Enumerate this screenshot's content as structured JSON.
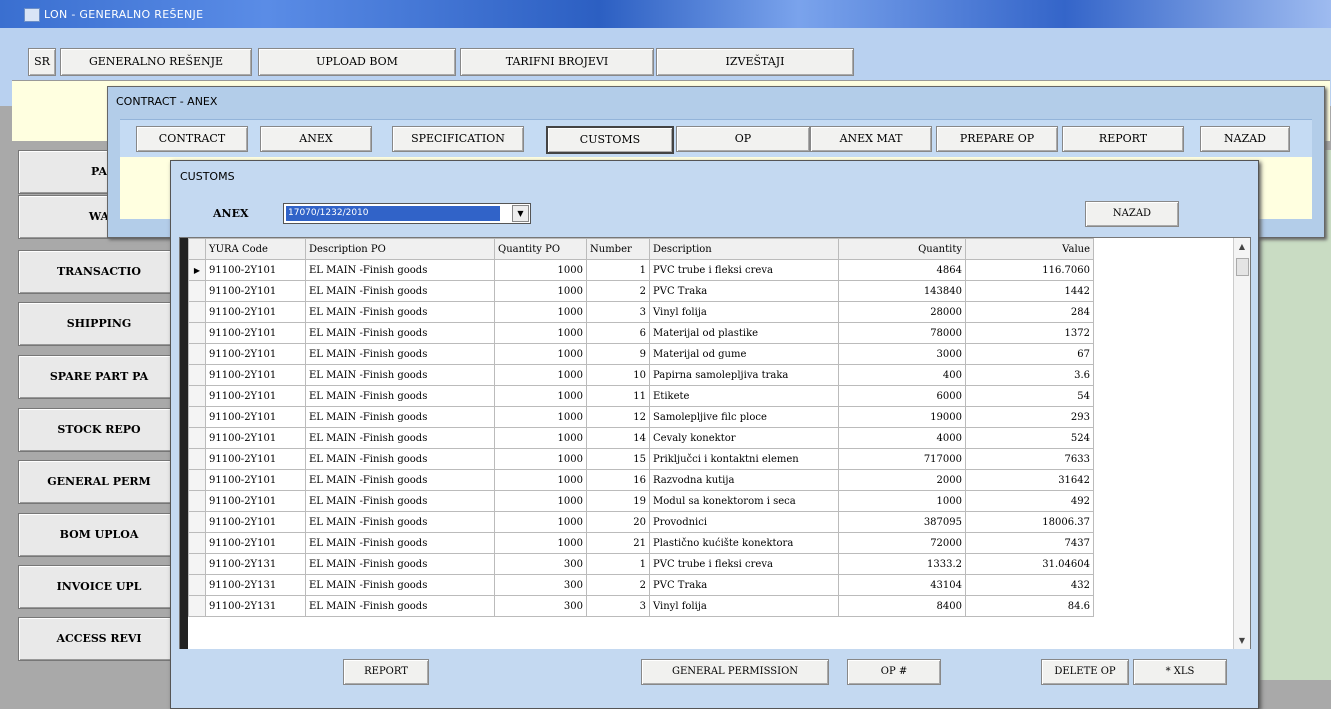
{
  "window_title": "LON - GENERALNO REŠENJE",
  "top_nav": [
    {
      "label": "SR"
    },
    {
      "label": "GENERALNO REŠENJE"
    },
    {
      "label": "UPLOAD BOM"
    },
    {
      "label": "TARIFNI BROJEVI"
    },
    {
      "label": "IZVEŠTAJI"
    }
  ],
  "sidebar": [
    {
      "label": "PA"
    },
    {
      "label": "WA"
    },
    {
      "label": "TRANSACTIO"
    },
    {
      "label": "SHIPPING"
    },
    {
      "label": "SPARE PART PA"
    },
    {
      "label": "STOCK REPO"
    },
    {
      "label": "GENERAL PERM"
    },
    {
      "label": "BOM UPLOA"
    },
    {
      "label": "INVOICE UPL"
    },
    {
      "label": "ACCESS REVI"
    }
  ],
  "contract_window": {
    "title": "CONTRACT - ANEX",
    "buttons": [
      {
        "label": "CONTRACT"
      },
      {
        "label": "ANEX"
      },
      {
        "label": "SPECIFICATION"
      },
      {
        "label": "CUSTOMS"
      },
      {
        "label": "OP"
      },
      {
        "label": "ANEX MAT"
      },
      {
        "label": "PREPARE OP"
      },
      {
        "label": "REPORT"
      },
      {
        "label": "NAZAD"
      }
    ]
  },
  "customs_window": {
    "title": "CUSTOMS",
    "anex_label": "ANEX",
    "anex_value": "17070/1232/2010",
    "nazad_label": "NAZAD",
    "columns": [
      "YURA Code",
      "Description PO",
      "Quantity PO",
      "Number",
      "Description",
      "Quantity",
      "Value"
    ],
    "rows": [
      [
        "91100-2Y101",
        "EL MAIN -Finish goods",
        "1000",
        "1",
        "PVC trube i fleksi creva",
        "4864",
        "116.7060"
      ],
      [
        "91100-2Y101",
        "EL MAIN -Finish goods",
        "1000",
        "2",
        "PVC Traka",
        "143840",
        "1442"
      ],
      [
        "91100-2Y101",
        "EL MAIN -Finish goods",
        "1000",
        "3",
        "Vinyl folija",
        "28000",
        "284"
      ],
      [
        "91100-2Y101",
        "EL MAIN -Finish goods",
        "1000",
        "6",
        "Materijal od plastike",
        "78000",
        "1372"
      ],
      [
        "91100-2Y101",
        "EL MAIN -Finish goods",
        "1000",
        "9",
        "Materijal od gume",
        "3000",
        "67"
      ],
      [
        "91100-2Y101",
        "EL MAIN -Finish goods",
        "1000",
        "10",
        "Papirna samolepljiva traka",
        "400",
        "3.6"
      ],
      [
        "91100-2Y101",
        "EL MAIN -Finish goods",
        "1000",
        "11",
        "Etikete",
        "6000",
        "54"
      ],
      [
        "91100-2Y101",
        "EL MAIN -Finish goods",
        "1000",
        "12",
        "Samolepljive filc ploce",
        "19000",
        "293"
      ],
      [
        "91100-2Y101",
        "EL MAIN -Finish goods",
        "1000",
        "14",
        "Cevaly konektor",
        "4000",
        "524"
      ],
      [
        "91100-2Y101",
        "EL MAIN -Finish goods",
        "1000",
        "15",
        "Priključci i kontaktni elemen",
        "717000",
        "7633"
      ],
      [
        "91100-2Y101",
        "EL MAIN -Finish goods",
        "1000",
        "16",
        "Razvodna kutija",
        "2000",
        "31642"
      ],
      [
        "91100-2Y101",
        "EL MAIN -Finish goods",
        "1000",
        "19",
        "Modul sa konektorom i seca",
        "1000",
        "492"
      ],
      [
        "91100-2Y101",
        "EL MAIN -Finish goods",
        "1000",
        "20",
        "Provodnici",
        "387095",
        "18006.37"
      ],
      [
        "91100-2Y101",
        "EL MAIN -Finish goods",
        "1000",
        "21",
        "Plastično kućište konektora",
        "72000",
        "7437"
      ],
      [
        "91100-2Y131",
        "EL MAIN -Finish goods",
        "300",
        "1",
        "PVC trube i fleksi creva",
        "1333.2",
        "31.04604"
      ],
      [
        "91100-2Y131",
        "EL MAIN -Finish goods",
        "300",
        "2",
        "PVC Traka",
        "43104",
        "432"
      ],
      [
        "91100-2Y131",
        "EL MAIN -Finish goods",
        "300",
        "3",
        "Vinyl folija",
        "8400",
        "84.6"
      ]
    ],
    "bottom_buttons": [
      {
        "label": "REPORT"
      },
      {
        "label": "GENERAL PERMISSION"
      },
      {
        "label": "OP #"
      },
      {
        "label": "DELETE OP"
      },
      {
        "label": "* XLS"
      }
    ]
  }
}
